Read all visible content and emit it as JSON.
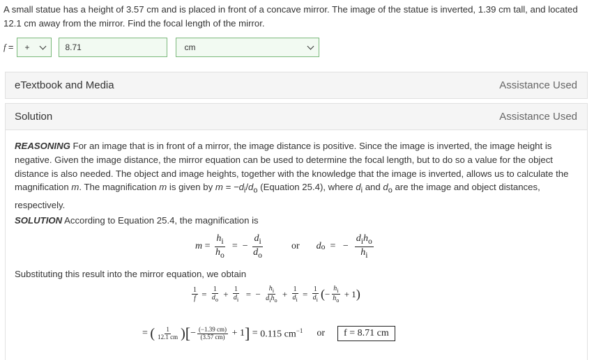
{
  "question": {
    "text": "A small statue has a height of 3.57 cm and is placed in front of a concave mirror. The image of the statue is inverted, 1.39 cm tall, and located 12.1 cm away from the mirror. Find the focal length of the mirror."
  },
  "answer": {
    "var": "f",
    "eq": "=",
    "sign": "+",
    "value": "8.71",
    "unit": "cm"
  },
  "panels": {
    "etextbook_title": "eTextbook and Media",
    "etextbook_status": "Assistance Used",
    "solution_title": "Solution",
    "solution_status": "Assistance Used"
  },
  "solution": {
    "reasoning_label": "REASONING",
    "reasoning_text_1": " For an image that is in front of a mirror, the image distance is positive. Since the image is inverted, the image height is negative. Given the image distance, the mirror equation can be used to determine the focal length, but to do so a value for the object distance is also needed. The object and image heights, together with the knowledge that the image is inverted, allows us to calculate the magnification ",
    "m": "m",
    "reasoning_text_2": ". The magnification ",
    "reasoning_text_3": " is given by ",
    "reasoning_formula": "m = −d",
    "reasoning_text_4": " (Equation 25.4), where ",
    "reasoning_text_5": " and ",
    "reasoning_text_6": " are the image and object distances, respectively.",
    "solution_label": "SOLUTION",
    "solution_text": " According to Equation 25.4, the magnification is",
    "substituting_text": "Substituting this result into the mirror equation, we obtain",
    "or": "or",
    "result": "0.115 cm",
    "result_exp": "−1",
    "final_answer": "f = 8.71 cm",
    "num_12": "1",
    "den_12": "12.1 cm",
    "num_139": "(−1.39 cm)",
    "den_357": "(3.57 cm)",
    "plus_one": "+ 1"
  }
}
